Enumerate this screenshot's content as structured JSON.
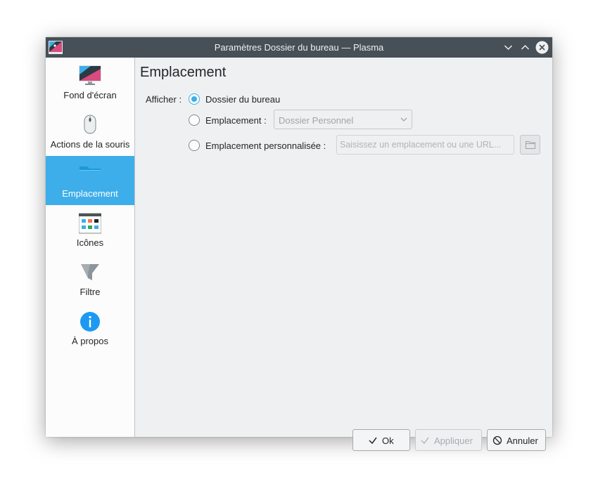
{
  "window": {
    "title": "Paramètres Dossier du bureau — Plasma",
    "controls": [
      "minimize",
      "maximize",
      "close"
    ]
  },
  "sidebar": {
    "items": [
      {
        "label": "Fond d'écran",
        "icon": "wallpaper-icon",
        "active": false
      },
      {
        "label": "Actions de la souris",
        "icon": "mouse-icon",
        "active": false
      },
      {
        "label": "Emplacement",
        "icon": "folder-icon",
        "active": true
      },
      {
        "label": "Icônes",
        "icon": "icons-view-icon",
        "active": false
      },
      {
        "label": "Filtre",
        "icon": "filter-icon",
        "active": false
      },
      {
        "label": "À propos",
        "icon": "info-icon",
        "active": false
      }
    ]
  },
  "page": {
    "title": "Emplacement",
    "show_label": "Afficher :",
    "options": [
      {
        "label": "Dossier du bureau",
        "checked": true
      },
      {
        "label": "Emplacement :",
        "checked": false
      },
      {
        "label": "Emplacement personnalisée :",
        "checked": false
      }
    ],
    "location_combo": {
      "value": "Dossier Personnel",
      "enabled": false
    },
    "custom_url": {
      "placeholder": "Saisissez un emplacement ou une URL...",
      "value": "",
      "enabled": false
    }
  },
  "buttons": {
    "ok": "Ok",
    "apply": "Appliquer",
    "cancel": "Annuler"
  },
  "colors": {
    "accent": "#3daee9",
    "titlebar": "#475057",
    "window_bg": "#eff0f1",
    "sidebar_bg": "#fcfcfc"
  }
}
